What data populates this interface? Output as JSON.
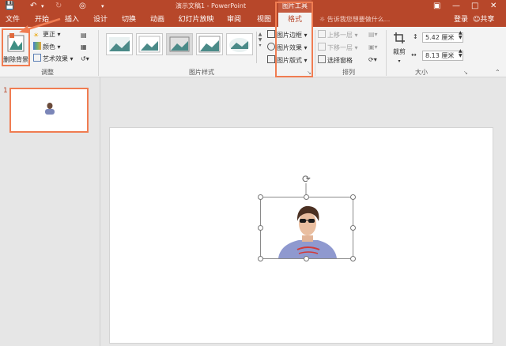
{
  "app": {
    "window_title": "演示文稿1 - PowerPoint",
    "context_tab_title": "图片工具"
  },
  "tabs": [
    {
      "label": "文件"
    },
    {
      "label": "开始"
    },
    {
      "label": "插入"
    },
    {
      "label": "设计"
    },
    {
      "label": "切换"
    },
    {
      "label": "动画"
    },
    {
      "label": "幻灯片放映"
    },
    {
      "label": "审阅"
    },
    {
      "label": "视图"
    },
    {
      "label": "格式",
      "active": true
    }
  ],
  "tell_me": "告诉我您想要做什么...",
  "account": {
    "login": "登录",
    "share": "共享"
  },
  "ribbon": {
    "adjust": {
      "remove_background": "删除背景",
      "corrections": "更正",
      "color": "颜色",
      "artistic_effects": "艺术效果",
      "group_label": "调整"
    },
    "picture_styles": {
      "border": "图片边框",
      "effects": "图片效果",
      "layout": "图片版式",
      "group_label": "图片样式"
    },
    "arrange": {
      "bring_forward": "上移一层",
      "send_backward": "下移一层",
      "selection_pane": "选择窗格",
      "group_label": "排列"
    },
    "size": {
      "crop": "裁剪",
      "height": "5.42 厘米",
      "width": "8.13 厘米",
      "group_label": "大小"
    }
  },
  "slides_panel": {
    "slide_number": "1"
  },
  "colors": {
    "accent": "#b7472a",
    "highlight": "#f07c51"
  }
}
